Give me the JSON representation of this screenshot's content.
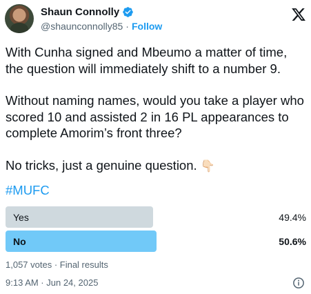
{
  "author": {
    "display_name": "Shaun Connolly",
    "handle": "@shaunconnolly85",
    "separator": "·",
    "follow_label": "Follow"
  },
  "tweet": {
    "paragraphs": [
      "With Cunha signed and Mbeumo a matter of time, the question will immediately shift to a number 9.",
      "Without naming names, would you take a player who scored 10 and assisted 2 in 16 PL appearances to complete Amorim’s front three?",
      "No tricks, just a genuine question."
    ],
    "emoji": "👇🏻",
    "hashtag": "#MUFC"
  },
  "poll": {
    "options": [
      {
        "label": "Yes",
        "percent_text": "49.4%",
        "value": 49.4,
        "winner": false
      },
      {
        "label": "No",
        "percent_text": "50.6%",
        "value": 50.6,
        "winner": true
      }
    ],
    "summary": "1,057 votes · Final results"
  },
  "meta": {
    "timestamp": "9:13 AM · Jun 24, 2025"
  },
  "icons": {
    "verified": "verified-badge-icon",
    "x": "x-logo-icon",
    "info": "info-icon",
    "emoji": "pointing-down-hand-icon"
  },
  "colors": {
    "accent": "#1d9bf0",
    "poll_winner": "#71c9f8",
    "poll_loser": "#cfd9de",
    "secondary_text": "#536471"
  }
}
